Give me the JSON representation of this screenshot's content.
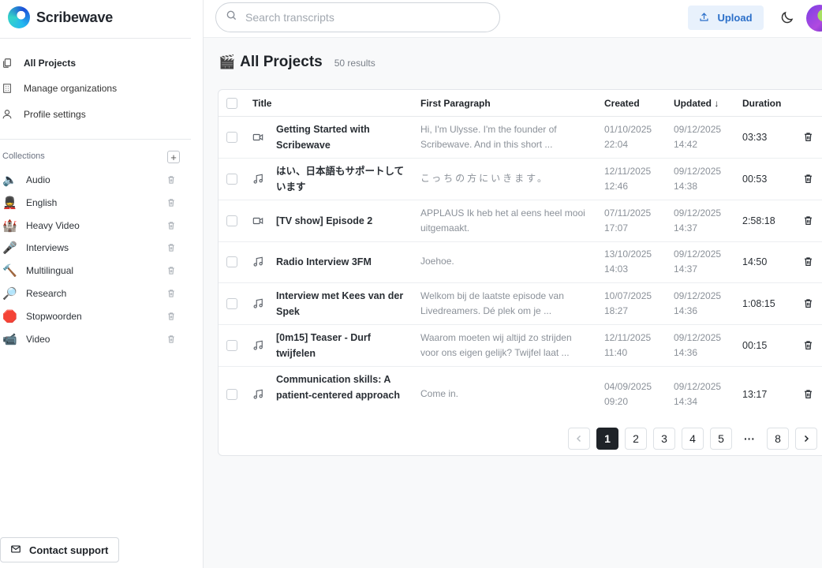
{
  "app": {
    "name": "Scribewave"
  },
  "sidebar": {
    "nav": [
      {
        "label": "All Projects",
        "icon": "copy-icon"
      },
      {
        "label": "Manage organizations",
        "icon": "building-icon"
      },
      {
        "label": "Profile settings",
        "icon": "user-icon"
      }
    ],
    "collections_label": "Collections",
    "collections": [
      {
        "label": "Audio",
        "emoji": "🔈"
      },
      {
        "label": "English",
        "emoji": "💂"
      },
      {
        "label": "Heavy Video",
        "emoji": "🏰"
      },
      {
        "label": "Interviews",
        "emoji": "🎤"
      },
      {
        "label": "Multilingual",
        "emoji": "🔨"
      },
      {
        "label": "Research",
        "emoji": "🔎"
      },
      {
        "label": "Stopwoorden",
        "emoji": "🛑"
      },
      {
        "label": "Video",
        "emoji": "📹"
      }
    ],
    "contact_label": "Contact support"
  },
  "header": {
    "search_placeholder": "Search transcripts",
    "upload_label": "Upload"
  },
  "main": {
    "title_emoji": "🎬",
    "title": "All Projects",
    "results": "50 results",
    "columns": {
      "title": "Title",
      "first_paragraph": "First Paragraph",
      "created": "Created",
      "updated": "Updated ↓",
      "duration": "Duration"
    },
    "rows": [
      {
        "type": "video",
        "title": "Getting Started with Scribewave",
        "paragraph": "Hi, I'm Ulysse. I'm the founder of Scribewave. And in this short ...",
        "created_date": "01/10/2025",
        "created_time": "22:04",
        "updated_date": "09/12/2025",
        "updated_time": "14:42",
        "duration": "03:33"
      },
      {
        "type": "audio",
        "title": "はい、日本語もサポートしています",
        "paragraph": "こっちの方にいきます。",
        "created_date": "12/11/2025",
        "created_time": "12:46",
        "updated_date": "09/12/2025",
        "updated_time": "14:38",
        "duration": "00:53"
      },
      {
        "type": "video",
        "title": "[TV show] Episode 2",
        "paragraph": "APPLAUS Ik heb het al eens heel mooi uitgemaakt.",
        "created_date": "07/11/2025",
        "created_time": "17:07",
        "updated_date": "09/12/2025",
        "updated_time": "14:37",
        "duration": "2:58:18"
      },
      {
        "type": "audio",
        "title": "Radio Interview 3FM",
        "paragraph": "Joehoe.",
        "created_date": "13/10/2025",
        "created_time": "14:03",
        "updated_date": "09/12/2025",
        "updated_time": "14:37",
        "duration": "14:50"
      },
      {
        "type": "audio",
        "title": "Interview met Kees van der Spek",
        "paragraph": "Welkom bij de laatste episode van Livedreamers. Dé plek om je ...",
        "created_date": "10/07/2025",
        "created_time": "18:27",
        "updated_date": "09/12/2025",
        "updated_time": "14:36",
        "duration": "1:08:15"
      },
      {
        "type": "audio",
        "title": "[0m15] Teaser - Durf twijfelen",
        "paragraph": "Waarom moeten wij altijd zo strijden voor ons eigen gelijk? Twijfel laat ...",
        "created_date": "12/11/2025",
        "created_time": "11:40",
        "updated_date": "09/12/2025",
        "updated_time": "14:36",
        "duration": "00:15"
      },
      {
        "type": "audio",
        "title": "Communication skills: A patient-centered approach",
        "paragraph": "Come in.",
        "created_date": "04/09/2025",
        "created_time": "09:20",
        "updated_date": "09/12/2025",
        "updated_time": "14:34",
        "duration": "13:17"
      }
    ],
    "pagination": {
      "pages": [
        "1",
        "2",
        "3",
        "4",
        "5",
        "···",
        "8"
      ],
      "current": "1"
    }
  },
  "colors": {
    "accent": "#2b6fc9",
    "upload_bg": "#e8f1fc",
    "active_page": "#1f2328"
  }
}
